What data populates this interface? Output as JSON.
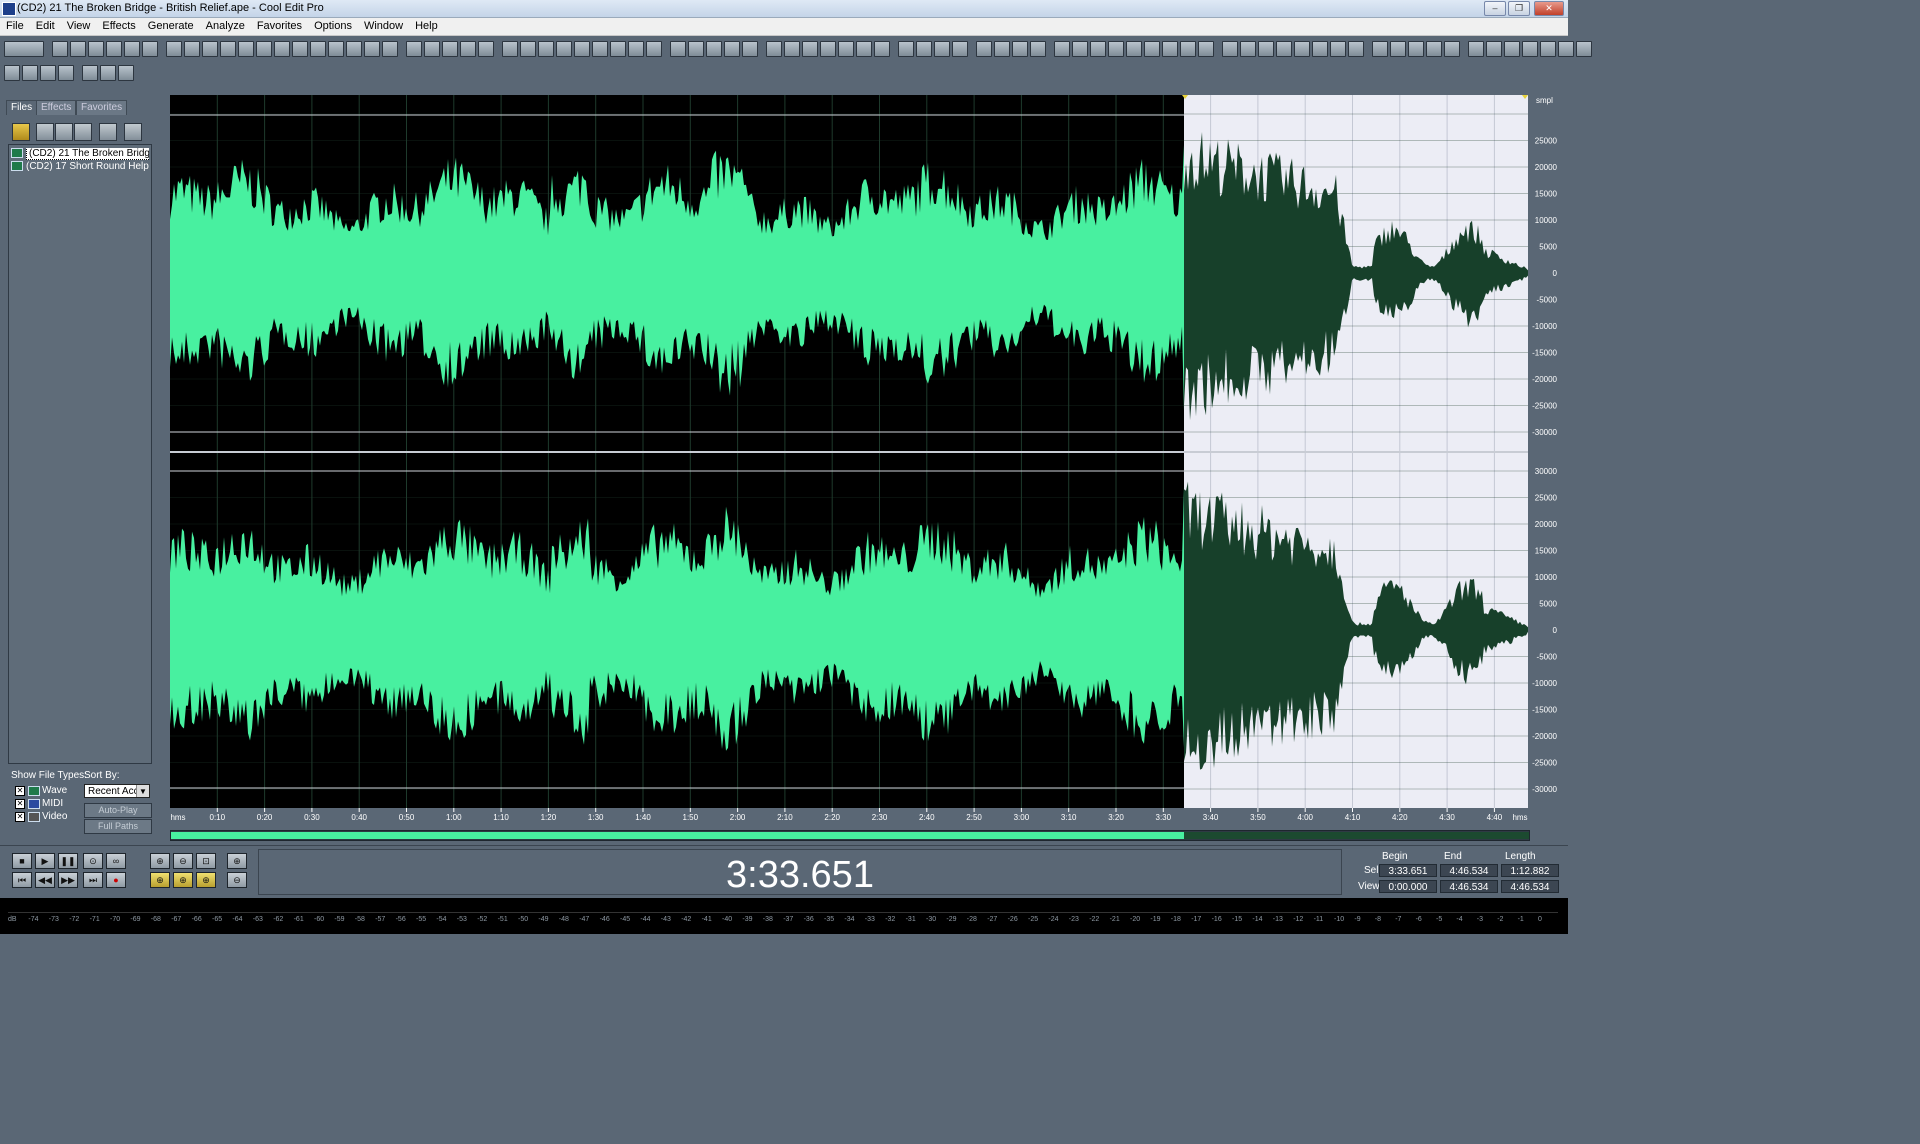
{
  "window": {
    "title": "(CD2) 21 The Broken Bridge - British Relief.ape - Cool Edit Pro",
    "buttons": [
      "–",
      "❐",
      "✕"
    ]
  },
  "menu": [
    "File",
    "Edit",
    "View",
    "Effects",
    "Generate",
    "Analyze",
    "Favorites",
    "Options",
    "Window",
    "Help"
  ],
  "sidebar": {
    "tabs": [
      "Files",
      "Effects",
      "Favorites"
    ],
    "active_tab": "Files",
    "files": [
      {
        "name": "(CD2) 21 The Broken Bridg...",
        "selected": true
      },
      {
        "name": "(CD2) 17 Short Round Help...",
        "selected": false
      }
    ],
    "show_file_types_label": "Show File Types:",
    "file_types": [
      {
        "label": "Wave",
        "checked": true
      },
      {
        "label": "MIDI",
        "checked": true
      },
      {
        "label": "Video",
        "checked": true
      }
    ],
    "sort_by_label": "Sort By:",
    "sort_by_value": "Recent Acc",
    "auto_play_label": "Auto-Play",
    "full_paths_label": "Full Paths"
  },
  "waveform": {
    "unit_label": "smpl",
    "time_unit": "hms",
    "amp_ticks_top": [
      "25000",
      "20000",
      "15000",
      "10000",
      "5000",
      "0",
      "-5000",
      "-10000",
      "-15000",
      "-20000",
      "-25000",
      "-30000"
    ],
    "amp_ticks_bottom": [
      "30000",
      "25000",
      "20000",
      "15000",
      "10000",
      "5000",
      "0",
      "-5000",
      "-10000",
      "-15000",
      "-20000",
      "-25000",
      "-30000"
    ],
    "time_ticks": [
      "0:10",
      "0:20",
      "0:30",
      "0:40",
      "0:50",
      "1:00",
      "1:10",
      "1:20",
      "1:30",
      "1:40",
      "1:50",
      "2:00",
      "2:10",
      "2:20",
      "2:30",
      "2:40",
      "2:50",
      "3:00",
      "3:10",
      "3:20",
      "3:30",
      "3:40",
      "3:50",
      "4:00",
      "4:10",
      "4:20",
      "4:30",
      "4:40"
    ],
    "selection_color": "#48f0a0",
    "unselected_wave_color": "#17402a",
    "selected_bg": "#000000",
    "unselected_bg": "#ecedf5"
  },
  "transport": {
    "current_time": "3:33.651",
    "headers": [
      "Begin",
      "End",
      "Length"
    ],
    "sel_label": "Sel",
    "view_label": "View",
    "sel": [
      "3:33.651",
      "4:46.534",
      "1:12.882"
    ],
    "view": [
      "0:00.000",
      "4:46.534",
      "4:46.534"
    ]
  },
  "meter": {
    "ticks": [
      "dB",
      "-74",
      "-73",
      "-72",
      "-71",
      "-70",
      "-69",
      "-68",
      "-67",
      "-66",
      "-65",
      "-64",
      "-63",
      "-62",
      "-61",
      "-60",
      "-59",
      "-58",
      "-57",
      "-56",
      "-55",
      "-54",
      "-53",
      "-52",
      "-51",
      "-50",
      "-49",
      "-48",
      "-47",
      "-46",
      "-45",
      "-44",
      "-43",
      "-42",
      "-41",
      "-40",
      "-39",
      "-38",
      "-37",
      "-36",
      "-35",
      "-34",
      "-33",
      "-32",
      "-31",
      "-30",
      "-29",
      "-28",
      "-27",
      "-26",
      "-25",
      "-24",
      "-23",
      "-22",
      "-21",
      "-20",
      "-19",
      "-18",
      "-17",
      "-16",
      "-15",
      "-14",
      "-13",
      "-12",
      "-11",
      "-10",
      "-9",
      "-8",
      "-7",
      "-6",
      "-5",
      "-4",
      "-3",
      "-2",
      "-1",
      "0"
    ]
  }
}
